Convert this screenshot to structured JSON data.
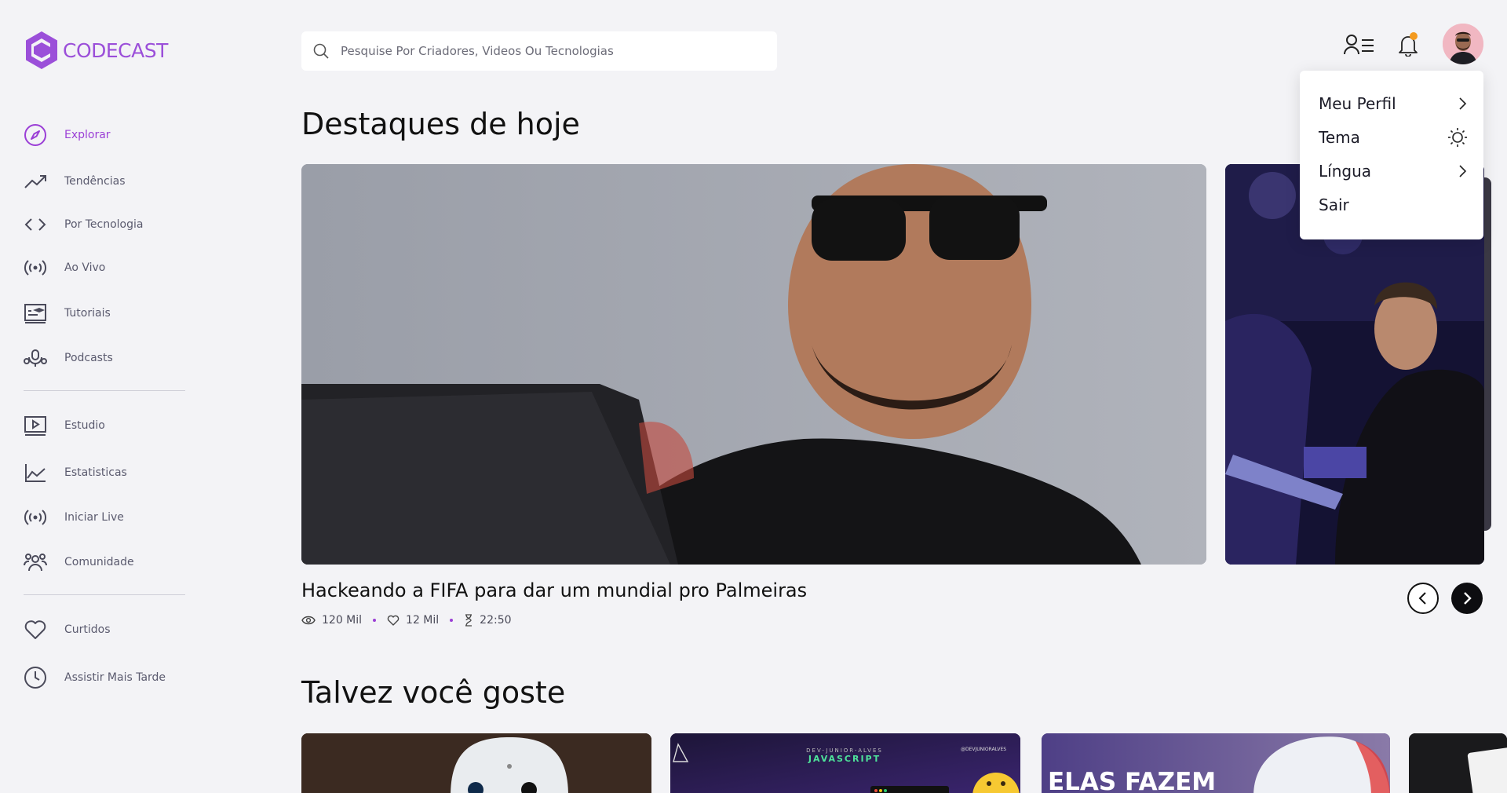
{
  "app": {
    "name": "CODECAST"
  },
  "search": {
    "placeholder": "Pesquise Por Criadores, Videos Ou Tecnologias"
  },
  "sidebar": {
    "items": [
      {
        "label": "Explorar",
        "icon": "compass-icon",
        "active": true
      },
      {
        "label": "Tendências",
        "icon": "trending-icon"
      },
      {
        "label": "Por Tecnologia",
        "icon": "code-icon"
      },
      {
        "label": "Ao Vivo",
        "icon": "broadcast-icon"
      },
      {
        "label": "Tutoriais",
        "icon": "tutorial-icon"
      },
      {
        "label": "Podcasts",
        "icon": "podcast-icon"
      },
      {
        "label": "Estudio",
        "icon": "studio-icon"
      },
      {
        "label": "Estatisticas",
        "icon": "stats-icon"
      },
      {
        "label": "Iniciar Live",
        "icon": "broadcast-icon"
      },
      {
        "label": "Comunidade",
        "icon": "community-icon"
      },
      {
        "label": "Curtidos",
        "icon": "heart-icon"
      },
      {
        "label": "Assistir Mais Tarde",
        "icon": "clock-icon"
      }
    ]
  },
  "menu": {
    "items": [
      {
        "label": "Meu Perfil",
        "icon": "chevron-right-icon"
      },
      {
        "label": "Tema",
        "icon": "sun-icon"
      },
      {
        "label": "Língua",
        "icon": "chevron-right-icon"
      },
      {
        "label": "Sair",
        "icon": ""
      }
    ]
  },
  "highlights": {
    "title": "Destaques de hoje",
    "video": {
      "title": "Hackeando a FIFA para dar um mundial pro Palmeiras",
      "views": "120 Mil",
      "likes": "12 Mil",
      "duration": "22:50"
    }
  },
  "recommendations": {
    "title": "Talvez você goste",
    "cards": [
      {
        "text": ""
      },
      {
        "text": "JAVASCRIPT",
        "subtext": "DEV-JUNIOR-ALVES",
        "handle": "@DEVJUNIORALVES"
      },
      {
        "text": "ELAS FAZEM"
      },
      {
        "text": ""
      }
    ]
  },
  "colors": {
    "accent": "#9b3fd6",
    "notification": "#f39a1f",
    "background": "#f3f3f6"
  }
}
